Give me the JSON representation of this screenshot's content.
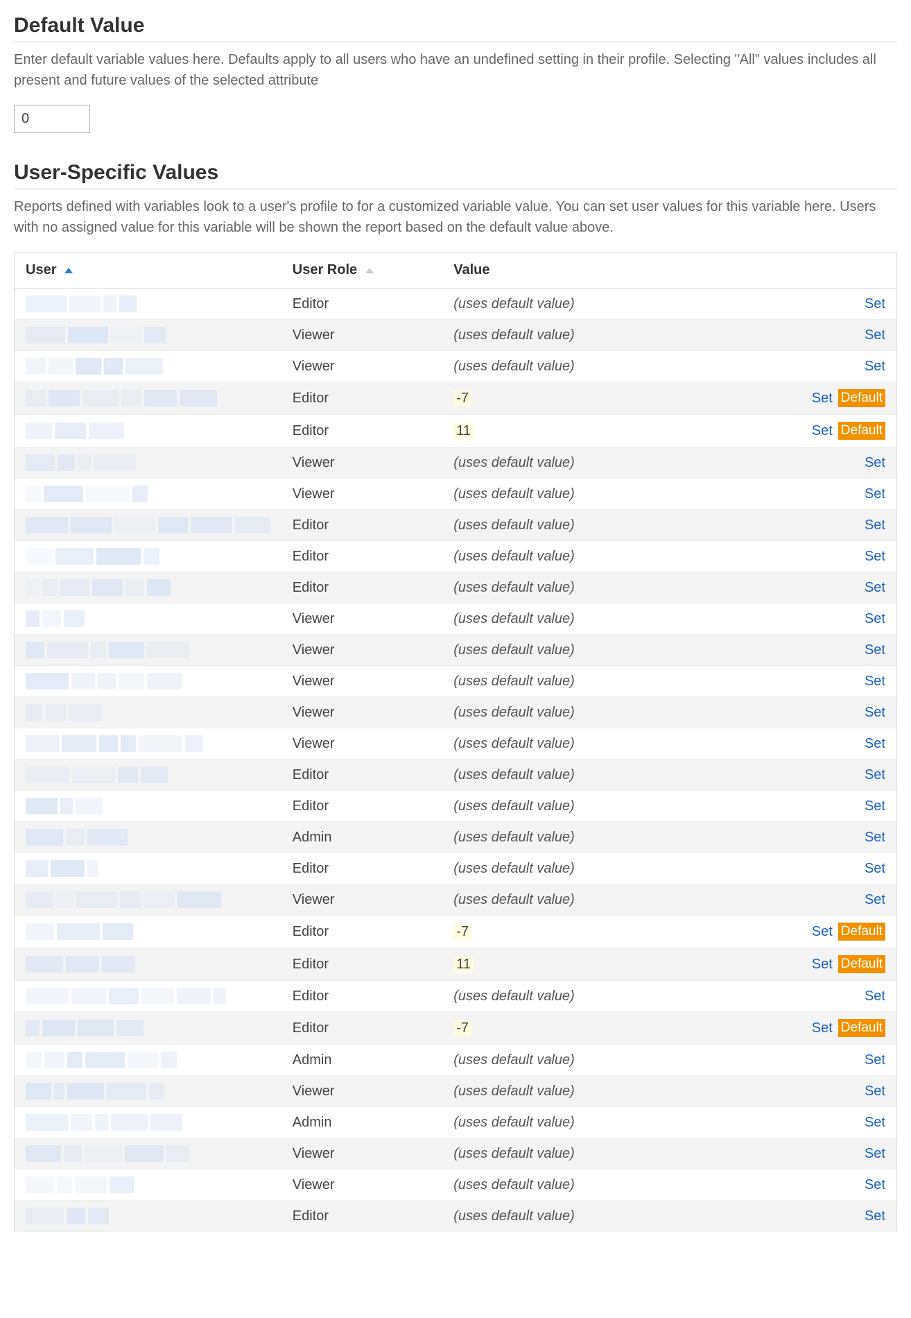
{
  "sections": {
    "default_value": {
      "title": "Default Value",
      "description": "Enter default variable values here. Defaults apply to all users who have an undefined setting in their profile. Selecting \"All\" values includes all present and future values of the selected attribute",
      "input_value": "0"
    },
    "user_specific": {
      "title": "User-Specific Values",
      "description": "Reports defined with variables look to a user's profile to for a customized variable value. You can set user values for this variable here. Users with no assigned value for this variable will be shown the report based on the default value above."
    }
  },
  "table": {
    "headers": {
      "user": "User",
      "role": "User Role",
      "value": "Value"
    },
    "uses_default_text": "(uses default value)",
    "set_label": "Set",
    "default_label": "Default",
    "rows": [
      {
        "role": "Editor",
        "value": null,
        "has_default_btn": false
      },
      {
        "role": "Viewer",
        "value": null,
        "has_default_btn": false
      },
      {
        "role": "Viewer",
        "value": null,
        "has_default_btn": false
      },
      {
        "role": "Editor",
        "value": "-7",
        "has_default_btn": true
      },
      {
        "role": "Editor",
        "value": "11",
        "has_default_btn": true
      },
      {
        "role": "Viewer",
        "value": null,
        "has_default_btn": false
      },
      {
        "role": "Viewer",
        "value": null,
        "has_default_btn": false
      },
      {
        "role": "Editor",
        "value": null,
        "has_default_btn": false
      },
      {
        "role": "Editor",
        "value": null,
        "has_default_btn": false
      },
      {
        "role": "Editor",
        "value": null,
        "has_default_btn": false
      },
      {
        "role": "Viewer",
        "value": null,
        "has_default_btn": false
      },
      {
        "role": "Viewer",
        "value": null,
        "has_default_btn": false
      },
      {
        "role": "Viewer",
        "value": null,
        "has_default_btn": false
      },
      {
        "role": "Viewer",
        "value": null,
        "has_default_btn": false
      },
      {
        "role": "Viewer",
        "value": null,
        "has_default_btn": false
      },
      {
        "role": "Editor",
        "value": null,
        "has_default_btn": false
      },
      {
        "role": "Editor",
        "value": null,
        "has_default_btn": false
      },
      {
        "role": "Admin",
        "value": null,
        "has_default_btn": false
      },
      {
        "role": "Editor",
        "value": null,
        "has_default_btn": false
      },
      {
        "role": "Viewer",
        "value": null,
        "has_default_btn": false
      },
      {
        "role": "Editor",
        "value": "-7",
        "has_default_btn": true
      },
      {
        "role": "Editor",
        "value": "11",
        "has_default_btn": true
      },
      {
        "role": "Editor",
        "value": null,
        "has_default_btn": false
      },
      {
        "role": "Editor",
        "value": "-7",
        "has_default_btn": true
      },
      {
        "role": "Admin",
        "value": null,
        "has_default_btn": false
      },
      {
        "role": "Viewer",
        "value": null,
        "has_default_btn": false
      },
      {
        "role": "Admin",
        "value": null,
        "has_default_btn": false
      },
      {
        "role": "Viewer",
        "value": null,
        "has_default_btn": false
      },
      {
        "role": "Viewer",
        "value": null,
        "has_default_btn": false
      },
      {
        "role": "Editor",
        "value": null,
        "has_default_btn": false
      }
    ]
  }
}
